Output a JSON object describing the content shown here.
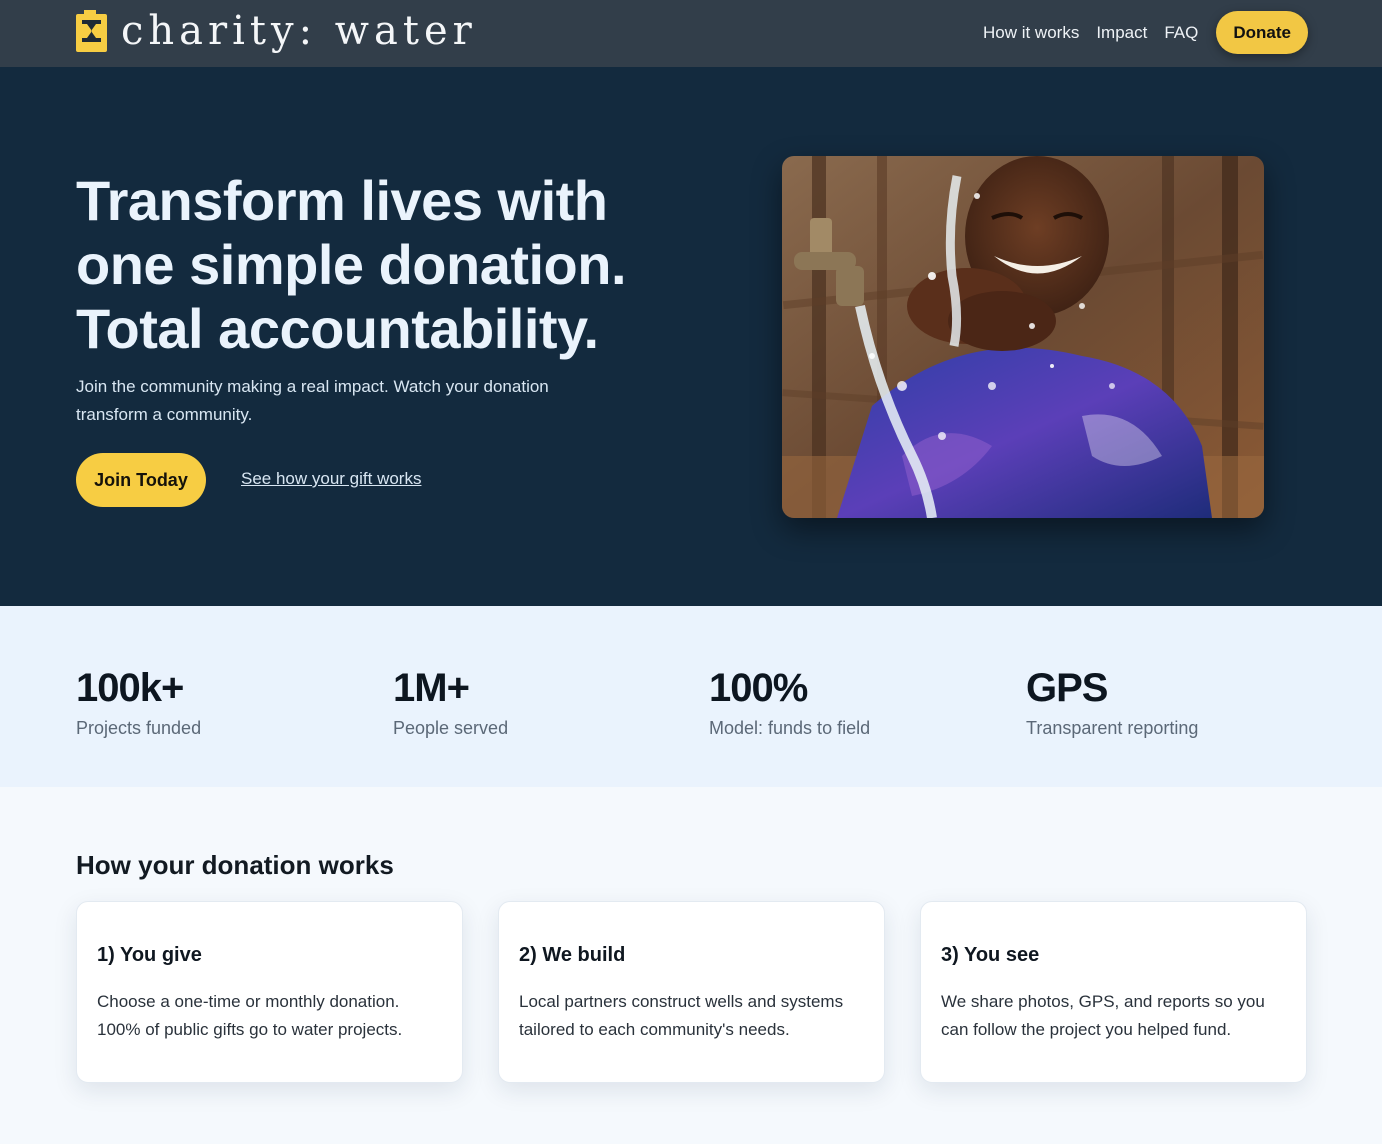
{
  "brand": {
    "name": "charity: water",
    "logo_icon": "jerry-can-icon",
    "accent_color": "#f7cd43"
  },
  "nav": {
    "links": [
      "How it works",
      "Impact",
      "FAQ"
    ],
    "donate_label": "Donate"
  },
  "hero": {
    "title": "Transform lives with one simple donation. Total accountability.",
    "subtitle": "Join the community making a real impact. Watch your donation transform a community.",
    "cta_primary": "Join Today",
    "cta_secondary": "See how your gift works",
    "background_color": "#132a3e"
  },
  "stats": [
    {
      "value": "100k+",
      "label": "Projects funded"
    },
    {
      "value": "1M+",
      "label": "People served"
    },
    {
      "value": "100%",
      "label": "Model: funds to field"
    },
    {
      "value": "GPS",
      "label": "Transparent reporting"
    }
  ],
  "how_it_works": {
    "title": "How your donation works",
    "steps": [
      {
        "title": "1) You give",
        "body": "Choose a one-time or monthly donation. 100% of public gifts go to water projects."
      },
      {
        "title": "2) We build",
        "body": "Local partners construct wells and systems tailored to each community's needs."
      },
      {
        "title": "3) You see",
        "body": "We share photos, GPS, and reports so you can follow the project you helped fund."
      }
    ]
  }
}
